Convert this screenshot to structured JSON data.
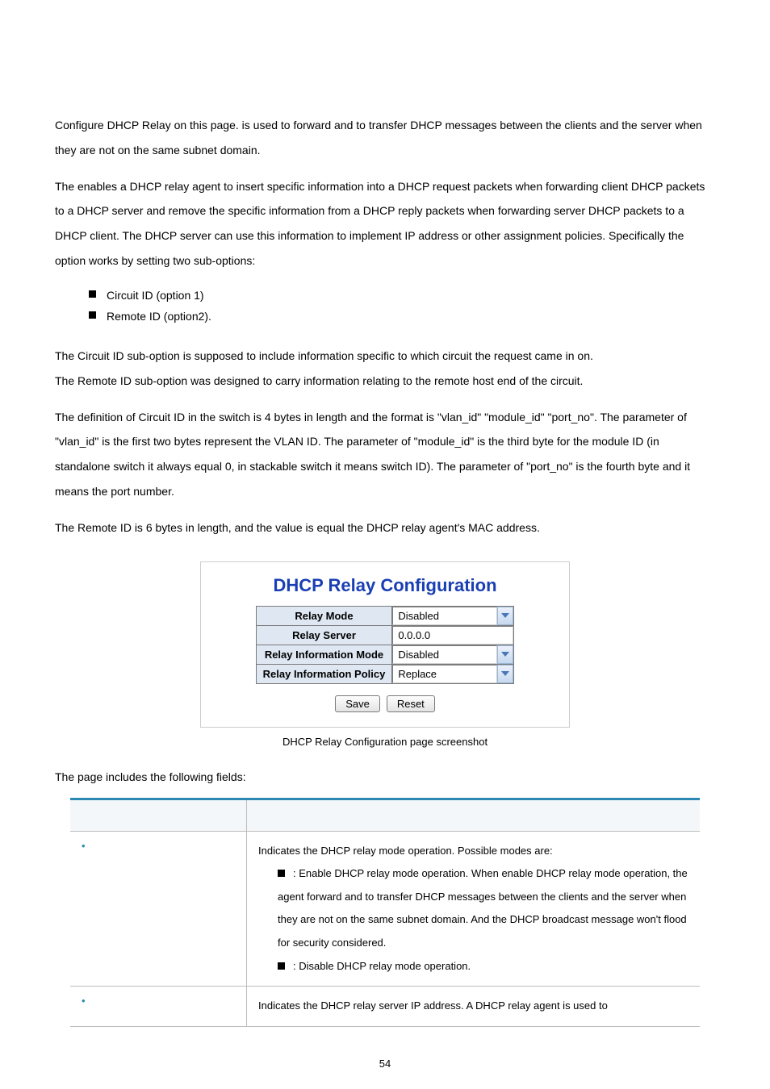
{
  "paragraphs": {
    "p1a": "Configure DHCP Relay on this page.",
    "p1b_bold": "",
    "p1c": " is used to forward and to transfer DHCP messages between the clients and the server when they are not on the same subnet domain.",
    "p2a": "The ",
    "p2b_bold": "",
    "p2c": " enables a DHCP relay agent to insert specific information into a DHCP request packets when forwarding client DHCP packets to a DHCP server and remove the specific information from a DHCP reply packets when forwarding server DHCP packets to a DHCP client. The DHCP server can use this information to implement IP address or other assignment policies. Specifically the option works by setting two sub-options:",
    "sub1": "Circuit ID (option 1)",
    "sub2": "Remote ID (option2).",
    "p3": "The Circuit ID sub-option is supposed to include information specific to which circuit the request came in on.",
    "p4": "The Remote ID sub-option was designed to carry information relating to the remote host end of the circuit.",
    "p5": "The definition of Circuit ID in the switch is 4 bytes in length and the format is \"vlan_id\" \"module_id\" \"port_no\". The parameter of \"vlan_id\" is the first two bytes represent the VLAN ID. The parameter of \"module_id\" is the third byte for the module ID (in standalone switch it always equal 0, in stackable switch it means switch ID). The parameter of \"port_no\" is the fourth byte and it means the port number.",
    "p6": "The Remote ID is 6 bytes in length, and the value is equal the DHCP relay agent's MAC address."
  },
  "figure": {
    "title": "DHCP Relay Configuration",
    "rows": {
      "relay_mode": {
        "label": "Relay Mode",
        "value": "Disabled"
      },
      "relay_server": {
        "label": "Relay Server",
        "value": "0.0.0.0"
      },
      "relay_info_mode": {
        "label": "Relay Information Mode",
        "value": "Disabled"
      },
      "relay_info_policy": {
        "label": "Relay Information Policy",
        "value": "Replace"
      }
    },
    "buttons": {
      "save": "Save",
      "reset": "Reset"
    },
    "caption": "DHCP Relay Configuration page screenshot"
  },
  "fields_intro": "The page includes the following fields:",
  "fields": {
    "header": {
      "object": "",
      "description": ""
    },
    "row1": {
      "object": "",
      "intro": "Indicates the DHCP relay mode operation. Possible modes are:",
      "enabled_label": "",
      "enabled_text": ": Enable DHCP relay mode operation. When enable DHCP relay mode operation, the agent forward and to transfer DHCP messages between the clients and the server when they are not on the same subnet domain. And the DHCP broadcast message won't flood for security considered.",
      "disabled_label": "",
      "disabled_text": ": Disable DHCP relay mode operation."
    },
    "row2": {
      "object": "",
      "text": "Indicates the DHCP relay server IP address. A DHCP relay agent is used to"
    }
  },
  "chart_data": {
    "type": "table",
    "title": "DHCP Relay Configuration",
    "rows": [
      {
        "field": "Relay Mode",
        "value": "Disabled",
        "control": "select"
      },
      {
        "field": "Relay Server",
        "value": "0.0.0.0",
        "control": "text"
      },
      {
        "field": "Relay Information Mode",
        "value": "Disabled",
        "control": "select"
      },
      {
        "field": "Relay Information Policy",
        "value": "Replace",
        "control": "select"
      }
    ]
  },
  "page_number": "54"
}
